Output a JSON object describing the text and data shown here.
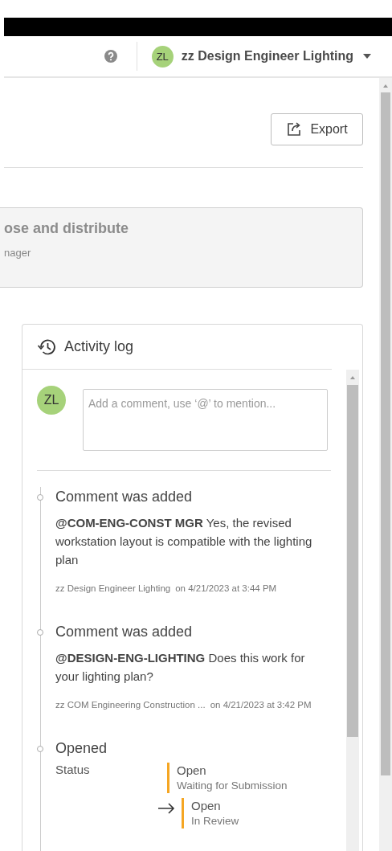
{
  "header": {
    "avatar_initials": "ZL",
    "user_name": "zz Design Engineer Lighting"
  },
  "export_button": "Export",
  "step_card": {
    "title": "ose and distribute",
    "subtitle": "nager"
  },
  "activity_log": {
    "title": "Activity log",
    "composer": {
      "initials": "ZL",
      "placeholder": "Add a comment, use ‘@’ to mention..."
    },
    "entries": [
      {
        "kind": "comment",
        "title": "Comment was added",
        "text": "**@COM-ENG-CONST MGR** Yes, the revised workstation layout is compatible with the lighting plan",
        "author": "zz Design Engineer Lighting",
        "when": "on 4/21/2023 at 3:44 PM"
      },
      {
        "kind": "comment",
        "title": "Comment was added",
        "text": "**@DESIGN-ENG-LIGHTING** Does this work for your lighting plan?",
        "author": "zz COM Engineering Construction ...",
        "when": "on 4/21/2023 at 3:42 PM"
      },
      {
        "kind": "status_change",
        "title": "Opened",
        "field": "Status",
        "from": {
          "status": "Open",
          "detail": "Waiting for Submission"
        },
        "to": {
          "status": "Open",
          "detail": "In Review"
        }
      }
    ]
  }
}
